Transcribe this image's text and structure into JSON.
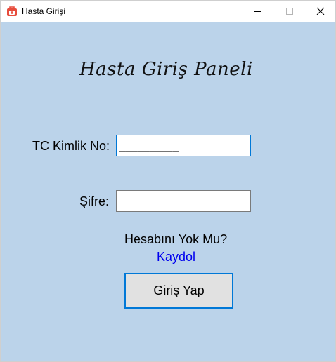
{
  "window": {
    "title": "Hasta Girişi",
    "icon": "medical-bag-icon"
  },
  "panel": {
    "heading": "Hasta Giriş Paneli"
  },
  "form": {
    "tc_label": "TC Kimlik No:",
    "tc_value": "__________",
    "password_label": "Şifre:",
    "password_value": "",
    "no_account_text": "Hesabını Yok Mu?",
    "register_link": "Kaydol",
    "login_button": "Giriş Yap"
  },
  "colors": {
    "client_background": "#bbd3ea",
    "focus_border": "#0078d7",
    "link": "#0000ee",
    "icon_red": "#e74c3c"
  }
}
